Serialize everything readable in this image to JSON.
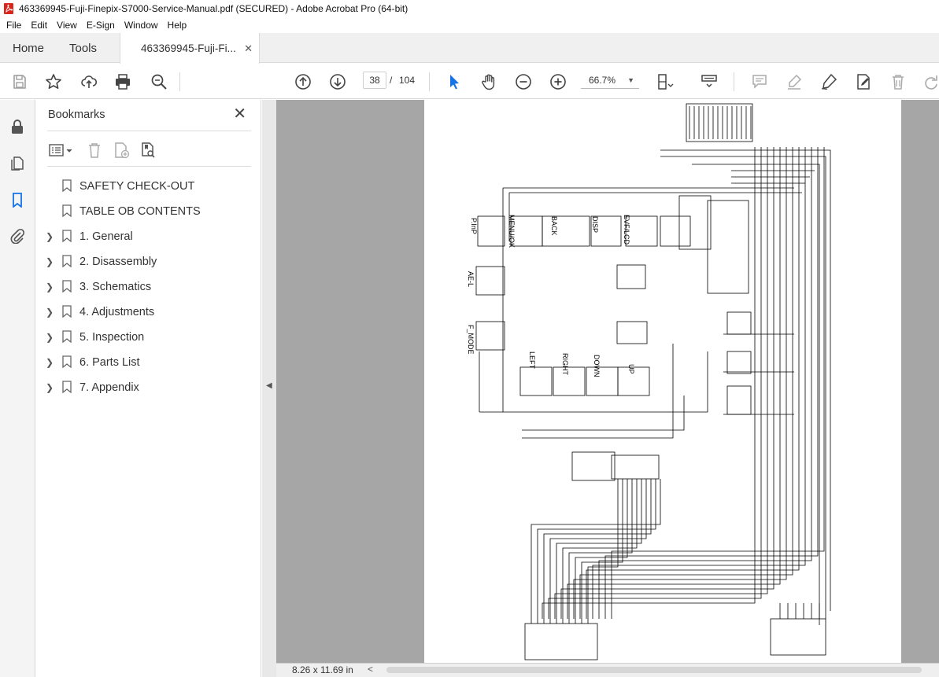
{
  "window": {
    "title": "463369945-Fuji-Finepix-S7000-Service-Manual.pdf (SECURED) - Adobe Acrobat Pro (64-bit)"
  },
  "menu": {
    "items": [
      "File",
      "Edit",
      "View",
      "E-Sign",
      "Window",
      "Help"
    ]
  },
  "tabs": {
    "home": "Home",
    "tools": "Tools",
    "document": "463369945-Fuji-Fi...",
    "close_glyph": "✕"
  },
  "toolbar": {
    "current_page": "38",
    "page_separator": "/",
    "total_pages": "104",
    "zoom": "66.7%",
    "icons": [
      "save-icon",
      "bookmark-star-icon",
      "upload-icon",
      "print-icon",
      "search-zoom-icon",
      "page-up-icon",
      "page-down-icon",
      "select-cursor-icon",
      "hand-icon",
      "zoom-out-icon",
      "zoom-in-icon",
      "page-display-icon",
      "scroll-mode-icon",
      "comment-icon",
      "highlight-icon",
      "sign-icon",
      "edit-icon",
      "delete-icon",
      "redo-icon"
    ]
  },
  "bookmarks": {
    "header": "Bookmarks",
    "close_glyph": "✕",
    "items": [
      {
        "label": "SAFETY CHECK-OUT",
        "expandable": false
      },
      {
        "label": "TABLE OB CONTENTS",
        "expandable": false
      },
      {
        "label": "1. General",
        "expandable": true
      },
      {
        "label": "2. Disassembly",
        "expandable": true
      },
      {
        "label": "3. Schematics",
        "expandable": true
      },
      {
        "label": "4. Adjustments",
        "expandable": true
      },
      {
        "label": "5. Inspection",
        "expandable": true
      },
      {
        "label": "6. Parts List",
        "expandable": true
      },
      {
        "label": "7. Appendix",
        "expandable": true
      }
    ]
  },
  "schematic": {
    "labels": [
      "P.InP",
      "MENU/OK",
      "BACK",
      "DISP",
      "EVF/LCD",
      "AE-L",
      "F_MODE",
      "LEFT",
      "RIGHT",
      "DOWN",
      "UP"
    ]
  },
  "status": {
    "page_size": "8.26 x 11.69 in",
    "scroll_left": "<"
  },
  "colors": {
    "accent_blue": "#1473e6",
    "doc_background": "#a6a6a6"
  }
}
